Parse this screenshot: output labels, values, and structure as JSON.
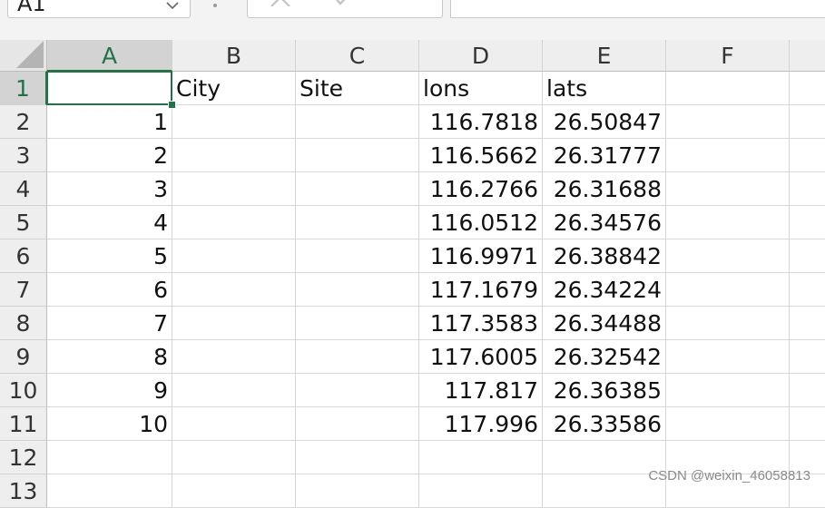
{
  "formula_bar": {
    "name_box": "A1",
    "cancel_icon": "close-icon",
    "enter_icon": "check-icon",
    "fx_icon": "fx-icon",
    "formula": ""
  },
  "columns": [
    "A",
    "B",
    "C",
    "D",
    "E",
    "F"
  ],
  "rows": [
    "1",
    "2",
    "3",
    "4",
    "5",
    "6",
    "7",
    "8",
    "9",
    "10",
    "11",
    "12",
    "13"
  ],
  "cells": [
    [
      "",
      "City",
      "Site",
      "lons",
      "lats",
      ""
    ],
    [
      "1",
      "",
      "",
      "116.7818",
      "26.50847",
      ""
    ],
    [
      "2",
      "",
      "",
      "116.5662",
      "26.31777",
      ""
    ],
    [
      "3",
      "",
      "",
      "116.2766",
      "26.31688",
      ""
    ],
    [
      "4",
      "",
      "",
      "116.0512",
      "26.34576",
      ""
    ],
    [
      "5",
      "",
      "",
      "116.9971",
      "26.38842",
      ""
    ],
    [
      "6",
      "",
      "",
      "117.1679",
      "26.34224",
      ""
    ],
    [
      "7",
      "",
      "",
      "117.3583",
      "26.34488",
      ""
    ],
    [
      "8",
      "",
      "",
      "117.6005",
      "26.32542",
      ""
    ],
    [
      "9",
      "",
      "",
      "117.817",
      "26.36385",
      ""
    ],
    [
      "10",
      "",
      "",
      "117.996",
      "26.33586",
      ""
    ],
    [
      "",
      "",
      "",
      "",
      "",
      ""
    ],
    [
      "",
      "",
      "",
      "",
      "",
      ""
    ]
  ],
  "active_cell": "A1",
  "colors": {
    "accent": "#217346",
    "header_bg": "#eeeeee",
    "selected_header_bg": "#d3d3d3",
    "grid_line": "#d9d9d9"
  },
  "watermark": "CSDN @weixin_46058813"
}
